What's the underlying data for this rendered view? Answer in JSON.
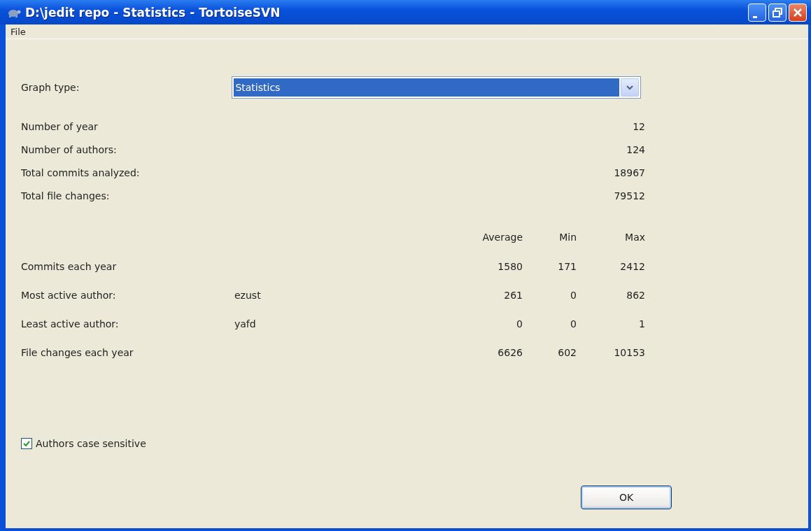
{
  "window": {
    "title": "D:\\jedit repo - Statistics - TortoiseSVN"
  },
  "menu": [
    "File"
  ],
  "graph_type": {
    "label": "Graph type:",
    "value": "Statistics"
  },
  "summary": [
    {
      "label": "Number of year",
      "value": "12"
    },
    {
      "label": "Number of authors:",
      "value": "124"
    },
    {
      "label": "Total commits analyzed:",
      "value": "18967"
    },
    {
      "label": "Total file changes:",
      "value": "79512"
    }
  ],
  "columns": [
    "Average",
    "Min",
    "Max"
  ],
  "stats": [
    {
      "label": "Commits each year",
      "average": "1580",
      "min": "171",
      "max": "2412"
    },
    {
      "label": "Most active author:",
      "author": "ezust",
      "average": "261",
      "min": "0",
      "max": "862"
    },
    {
      "label": "Least active author:",
      "author": "yafd",
      "average": "0",
      "min": "0",
      "max": "1"
    },
    {
      "label": "File changes each year",
      "average": "6626",
      "min": "602",
      "max": "10153"
    }
  ],
  "checkbox": {
    "label": "Authors case sensitive",
    "checked": true
  },
  "buttons": [
    "OK"
  ]
}
